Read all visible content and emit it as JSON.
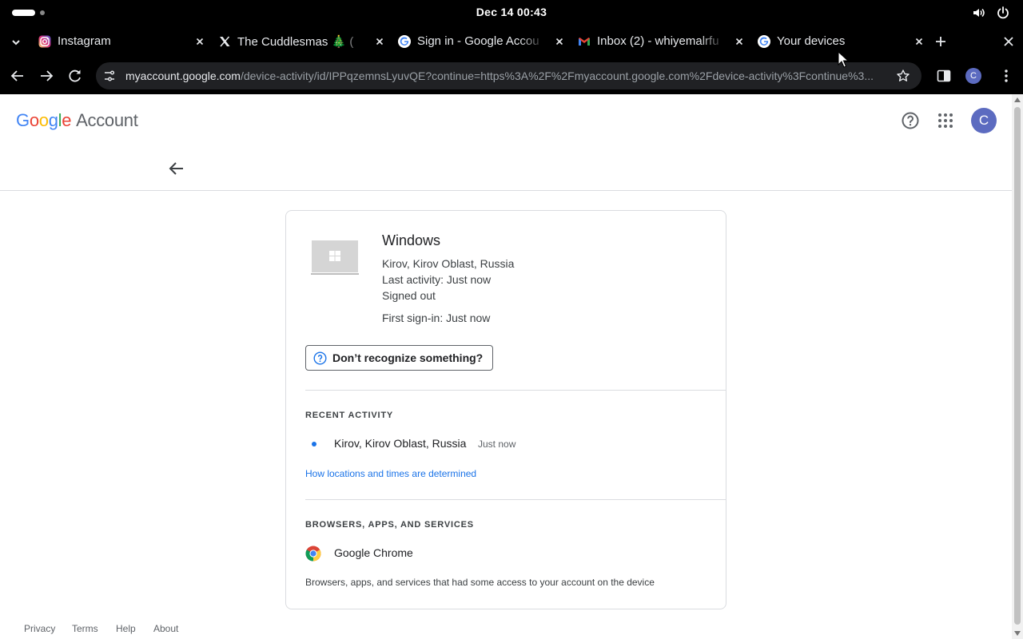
{
  "system": {
    "clock": "Dec 14  00:43"
  },
  "tabs": [
    {
      "title": "Instagram",
      "favicon": "instagram-icon"
    },
    {
      "title": "The Cuddlesmas 🎄 (",
      "favicon": "x-logo-icon"
    },
    {
      "title": "Sign in - Google Accou",
      "favicon": "google-g-icon"
    },
    {
      "title": "Inbox (2) - whiyemalrfu",
      "favicon": "gmail-icon"
    },
    {
      "title": "Your devices",
      "favicon": "google-g-icon",
      "active": true
    }
  ],
  "omnibox": {
    "host": "myaccount.google.com",
    "path": "/device-activity/id/IPPqzemnsLyuvQE?continue=https%3A%2F%2Fmyaccount.google.com%2Fdevice-activity%3Fcontinue%3..."
  },
  "profile_initial": "C",
  "header": {
    "logo": {
      "g1": "G",
      "o1": "o",
      "o2": "o",
      "g2": "g",
      "l": "l",
      "e": "e"
    },
    "title": "Account",
    "avatar_initial": "C"
  },
  "device": {
    "name": "Windows",
    "location": "Kirov, Kirov Oblast, Russia",
    "last_activity": "Last activity: Just now",
    "status": "Signed out",
    "first_signin": "First sign-in: Just now",
    "recognize_button": "Don’t recognize something?"
  },
  "recent_activity": {
    "heading": "RECENT ACTIVITY",
    "items": [
      {
        "location": "Kirov, Kirov Oblast, Russia",
        "time": "Just now"
      }
    ],
    "link": "How locations and times are determined"
  },
  "apps": {
    "heading": "BROWSERS, APPS, AND SERVICES",
    "items": [
      {
        "name": "Google Chrome",
        "icon": "chrome-icon"
      }
    ],
    "description": "Browsers, apps, and services that had some access to your account on the device"
  },
  "footer": {
    "privacy": "Privacy",
    "terms": "Terms",
    "help": "Help",
    "about": "About"
  },
  "colors": {
    "accent": "#1a73e8",
    "avatar": "#5c6bc0"
  }
}
